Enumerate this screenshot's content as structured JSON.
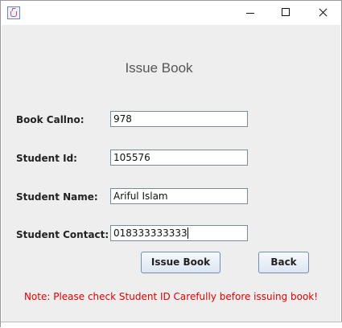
{
  "window": {
    "controls": {
      "minimize_icon": "minimize-icon",
      "maximize_icon": "maximize-icon",
      "close_icon": "close-icon"
    }
  },
  "form": {
    "title": "Issue Book",
    "fields": [
      {
        "label": "Book Callno:",
        "value": "978"
      },
      {
        "label": "Student Id:",
        "value": "105576"
      },
      {
        "label": "Student Name:",
        "value": "Ariful Islam"
      },
      {
        "label": "Student Contact:",
        "value": "018333333333"
      }
    ],
    "buttons": {
      "issue": "Issue Book",
      "back": "Back"
    },
    "note": "Note: Please check Student ID Carefully before issuing book!"
  },
  "colors": {
    "note_text": "#e00000",
    "panel_background": "#eeeeee",
    "button_border": "#6f8fb8"
  }
}
